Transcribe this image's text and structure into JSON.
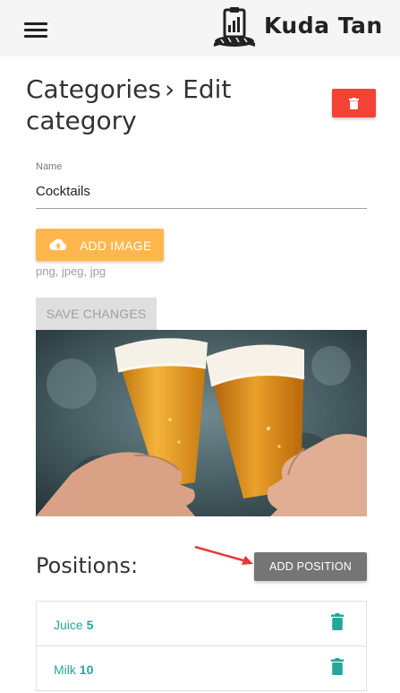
{
  "header": {
    "brand": "Kuda Tan",
    "menu_icon": "hamburger-menu-icon",
    "logo_icon": "clipboard-chart-bread-logo-icon"
  },
  "breadcrumb": {
    "parent": "Categories",
    "separator": "›",
    "current": "Edit category"
  },
  "delete_button": {
    "icon": "trash-icon",
    "color": "#f44336"
  },
  "form": {
    "name_label": "Name",
    "name_value": "Cocktails",
    "add_image_label": "ADD IMAGE",
    "add_image_icon": "cloud-upload-icon",
    "add_image_color": "#ffb74d",
    "file_hint": "png, jpeg, jpg",
    "save_label": "SAVE CHANGES"
  },
  "image": {
    "subject": "beer-glasses-toast-photo"
  },
  "positions": {
    "title": "Positions:",
    "add_label": "ADD POSITION",
    "items": [
      {
        "name": "Juice",
        "price": "5"
      },
      {
        "name": "Milk",
        "price": "10"
      }
    ],
    "link_color": "#26a69a"
  },
  "annotation": {
    "icon": "red-arrow-icon",
    "color": "#e53935"
  }
}
